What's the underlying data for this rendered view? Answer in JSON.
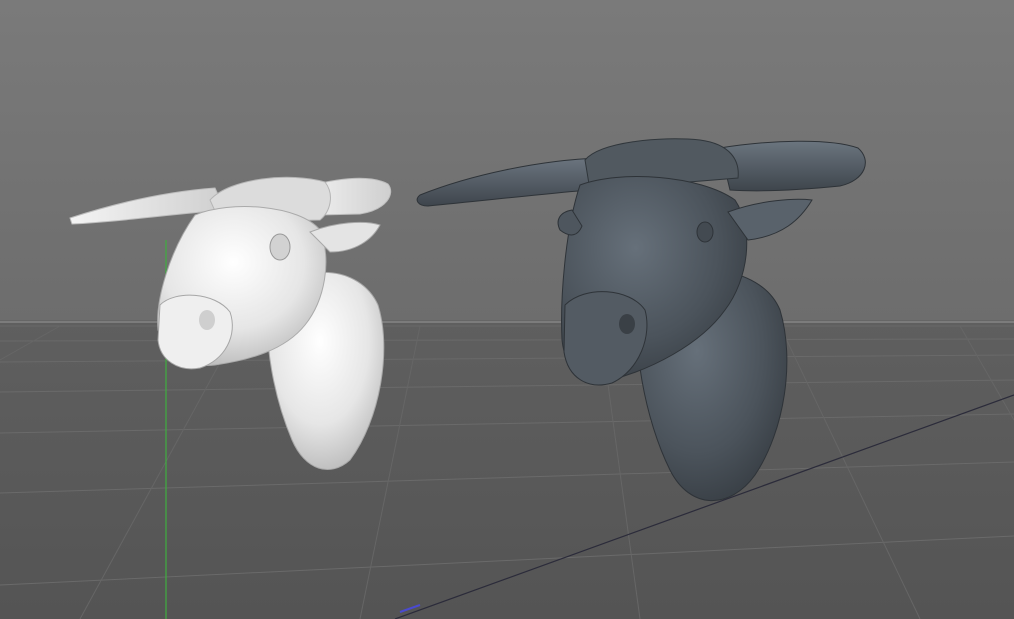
{
  "viewport": {
    "type": "3d-perspective-view",
    "colors": {
      "sky_top": "#7a7a7a",
      "sky_bottom": "#6d6d6d",
      "floor_near": "#545454",
      "grid_line": "#6e6e6e",
      "horizon_line": "#8c8c8c",
      "y_axis": "#3fae3f",
      "x_axis": "#b0b0c8",
      "z_axis": "#4a4ad0"
    }
  },
  "objects": [
    {
      "name": "bull-head-trophy-white",
      "material": "white-clay",
      "color": "#e8e8e8"
    },
    {
      "name": "bull-head-trophy-slate",
      "material": "slate-gray",
      "color": "#4b535b"
    }
  ]
}
